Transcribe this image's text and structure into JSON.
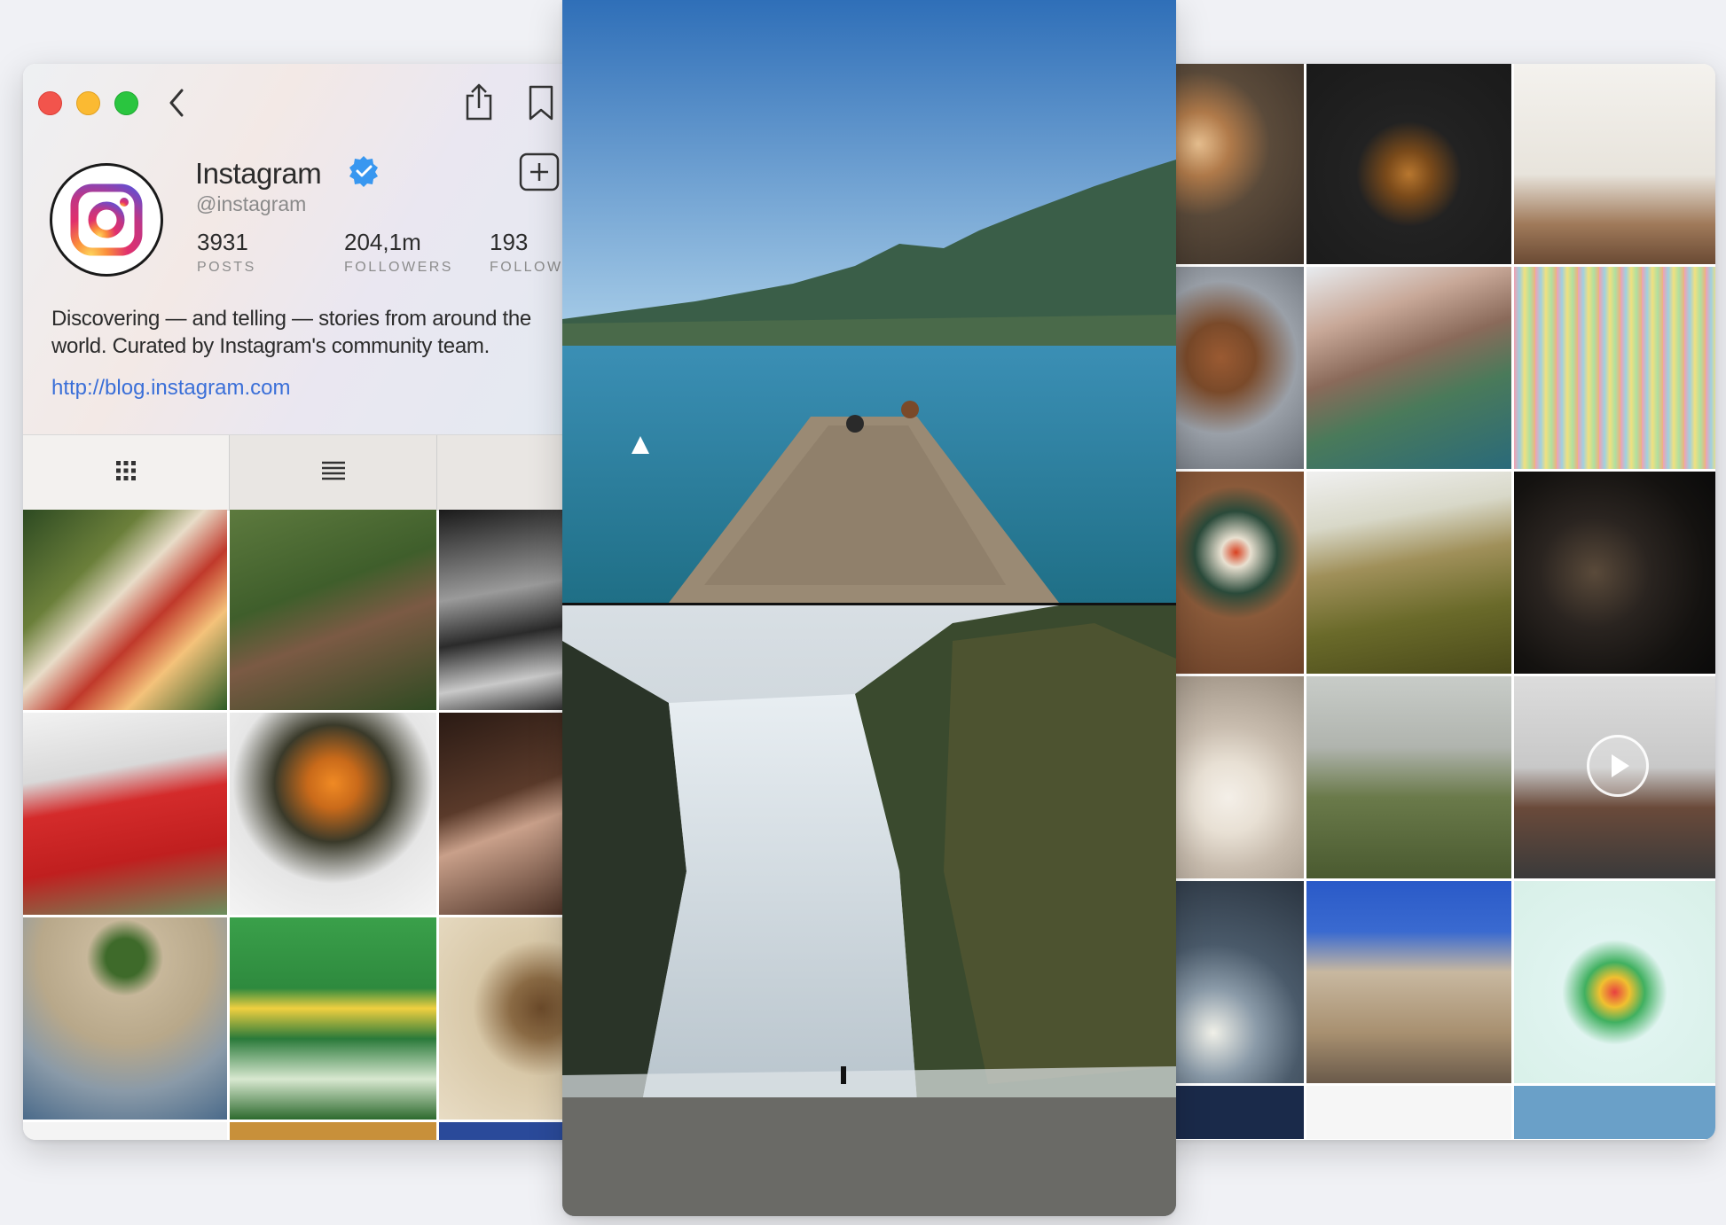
{
  "profile": {
    "name": "Instagram",
    "handle": "@instagram",
    "stats": [
      {
        "value": "3931",
        "label": "POSTS"
      },
      {
        "value": "204,1m",
        "label": "FOLLOWERS"
      },
      {
        "value": "193",
        "label": "FOLLOWING"
      }
    ],
    "bio": "Discovering — and telling — stories from around the world. Curated by Instagram's community team.",
    "link": "http://blog.instagram.com"
  },
  "toolbar": {
    "back_icon": "chevron-left-icon",
    "share_icon": "share-icon",
    "bookmark_icon": "bookmark-icon",
    "add_icon": "plus-square-icon"
  },
  "tabs": [
    {
      "icon": "grid-icon",
      "active": true
    },
    {
      "icon": "list-icon",
      "active": false
    },
    {
      "icon": "person-tag-icon",
      "active": false
    }
  ],
  "colors": {
    "link": "#3a6fd8",
    "verified": "#3897f0",
    "close": "#f2544c",
    "minimize": "#fbba32",
    "zoom": "#2ac53f"
  },
  "left_grid": [
    {
      "subject": "picnic",
      "bg": "linear-gradient(135deg,#2d4a22 0%,#6b7f3a 30%,#e8dcc8 45%,#c0392b 60%,#f4c27a 75%,#2e5d27 100%)"
    },
    {
      "subject": "elephants",
      "bg": "linear-gradient(160deg,#5d7a3e 0%,#3f5e2b 40%,#7b5a44 60%,#2f4a22 100%)"
    },
    {
      "subject": "monochrome-street",
      "bg": "linear-gradient(170deg,#1a1a1a 0%,#9a9a9a 40%,#2b2b2b 60%,#c9c9c9 80%,#111 100%)"
    },
    {
      "subject": "basketball-team",
      "bg": "linear-gradient(170deg,#f2f2f2 0%,#d9d9d9 30%,#d42b2b 45%,#c01f1f 70%,#6b8f5e 100%)"
    },
    {
      "subject": "flower-bouquet",
      "bg": "radial-gradient(circle at 50% 35%,#f08a24 0%,#c96a1a 15%,#3a3a2a 35%,#e6e6e6 60%,#f4f4f4 100%)"
    },
    {
      "subject": "party",
      "bg": "linear-gradient(160deg,#2a1a14 0%,#5a3a2a 40%,#c9a08a 55%,#3a2218 100%)"
    },
    {
      "subject": "aerial-plaza",
      "bg": "radial-gradient(circle at 50% 20%,#3e6a2a 0%,#3e6a2a 10%,#c7b79a 20%,#b8a88a 45%,#8a9aa8 70%,#4a6a8a 100%)"
    },
    {
      "subject": "olympic-medals",
      "bg": "linear-gradient(180deg,#3aa04a 0%,#2e8a3e 35%,#f0d040 45%,#2a7a3a 60%,#d8e8d0 80%,#2d6a2e 100%)"
    },
    {
      "subject": "lion",
      "bg": "radial-gradient(circle at 60% 45%,#6b4a2a 0%,#8a6a44 20%,#d8c8a8 45%,#e8dcc4 100%)"
    }
  ],
  "right_grid": [
    {
      "subject": "breakfast-bowls",
      "bg": "radial-gradient(circle at 30% 40%,#e8c090 0%,#b07a4a 20%,#5a4a3a 45%,#3a3028 100%)"
    },
    {
      "subject": "burger",
      "bg": "radial-gradient(circle at 50% 55%,#b8772f 0%,#7a4a1a 15%,#222 35%,#1a1a1a 100%)"
    },
    {
      "subject": "cat-litter-robot",
      "bg": "linear-gradient(180deg,#f4f2ee 0%,#e8e4dc 55%,#a07a5a 80%,#6a4a34 100%)"
    },
    {
      "subject": "poodle",
      "bg": "radial-gradient(circle at 45% 45%,#9a5a32 0%,#7a4a2a 25%,#9aa0a8 55%,#6a7078 100%)"
    },
    {
      "subject": "cliff-village",
      "bg": "linear-gradient(160deg,#e8ecf0 0%,#c8a898 25%,#8a6a5a 45%,#4a7a5a 65%,#2a6a7a 100%)"
    },
    {
      "subject": "colorful-stripes",
      "bg": "repeating-linear-gradient(90deg,#f2a0b0 0px,#a0d0e0 6px,#f0e080 12px,#b0e0a0 18px,#f0b080 24px)"
    },
    {
      "subject": "oysters-table",
      "bg": "radial-gradient(circle at 55% 40%,#d84020 0%,#e8e0d0 10%,#2a4a3a 28%,#8a5a3a 45%,#6a4028 100%)"
    },
    {
      "subject": "mountain-peacock",
      "bg": "linear-gradient(170deg,#f0f0f0 0%,#d8d8c8 25%,#a0905a 45%,#6a6a2a 70%,#4a4a1a 100%)"
    },
    {
      "subject": "night-bokeh",
      "bg": "radial-gradient(circle at 40% 50%,#5a4a3a 0%,#2a2420 35%,#141210 70%,#0a0a0a 100%)"
    },
    {
      "subject": "arched-corridor",
      "bg": "radial-gradient(circle at 50% 60%,#f4efe8 0%,#e8e0d4 25%,#c8bcae 50%,#9a8e80 100%)"
    },
    {
      "subject": "ram-field",
      "bg": "linear-gradient(180deg,#c8ccc8 0%,#b0b4ae 35%,#6a7a4a 60%,#4a5a30 100%)"
    },
    {
      "subject": "woman-rooftop-video",
      "bg": "linear-gradient(180deg,#dcdcdc 0%,#c8c8c8 45%,#6a4a3a 65%,#3a3a3a 100%)"
    },
    {
      "subject": "snowy-car",
      "bg": "radial-gradient(circle at 40% 75%,#f0f0e8 0%,#8a9aa8 25%,#4a5a6a 50%,#2a3440 100%)"
    },
    {
      "subject": "rock-formation",
      "bg": "linear-gradient(180deg,#2a5ac8 0%,#3a6ad0 25%,#c8b8a0 45%,#a89070 75%,#6a5a4a 100%)"
    },
    {
      "subject": "gummy-tree",
      "bg": "radial-gradient(circle at 50% 55%,#e84040 0%,#f0c030 10%,#40b060 20%,#e0f4f0 35%,#d8f0e8 100%)"
    }
  ],
  "featured": [
    {
      "subject": "lake-pier"
    },
    {
      "subject": "waterfall"
    }
  ]
}
